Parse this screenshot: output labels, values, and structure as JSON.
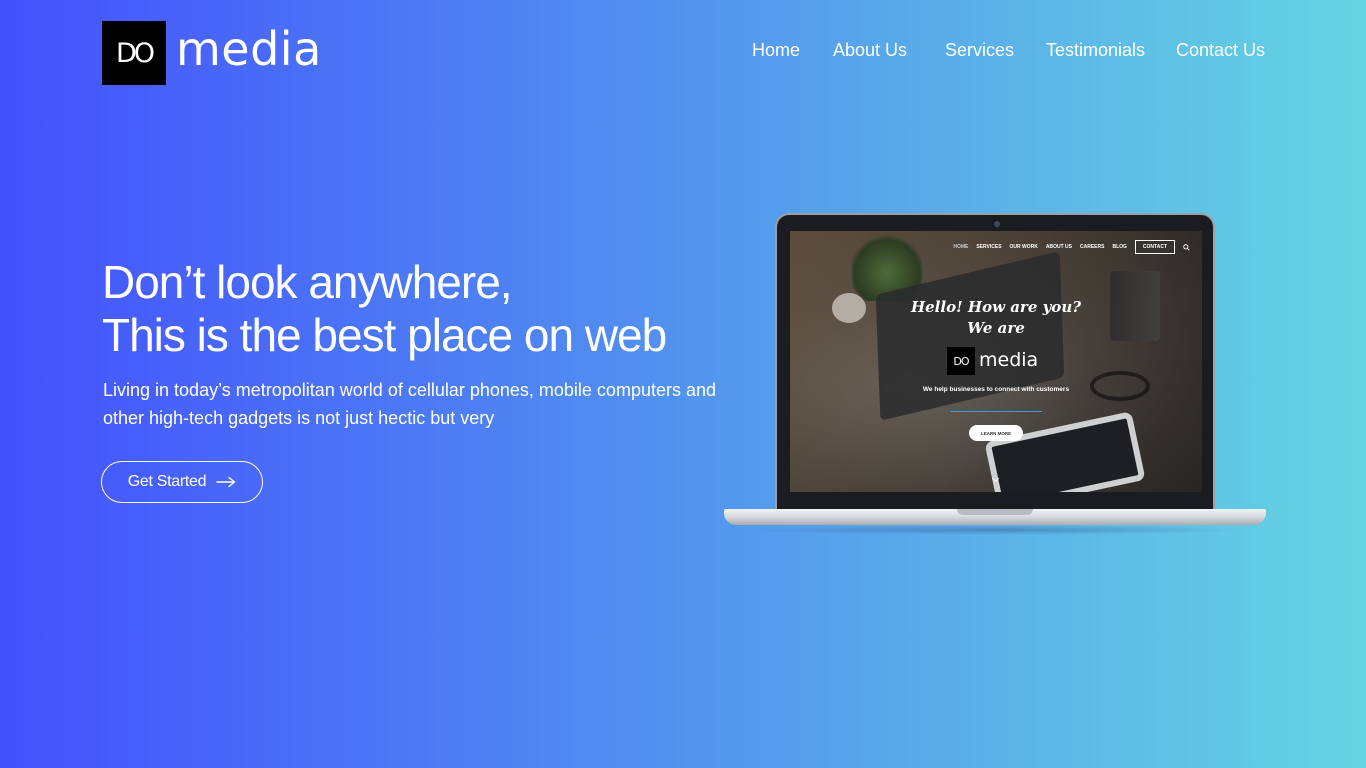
{
  "brand": {
    "logo_mark": "DO",
    "logo_word": "media"
  },
  "nav": {
    "items": [
      {
        "label": "Home"
      },
      {
        "label": "About Us"
      },
      {
        "label": "Services"
      },
      {
        "label": "Testimonials"
      },
      {
        "label": "Contact Us"
      }
    ]
  },
  "hero": {
    "title_line1": "Don’t look anywhere,",
    "title_line2": "This is the best place on web",
    "text": "Living in today’s metropolitan world of cellular phones, mobile computers and other high-tech gadgets is not just hectic but very",
    "cta_label": "Get Started",
    "cta_icon": "arrow-right-icon"
  },
  "screen_preview": {
    "nav": [
      "HOME",
      "SERVICES",
      "OUR WORK",
      "ABOUT US",
      "CAREERS",
      "BLOG"
    ],
    "contact_label": "CONTACT",
    "search_icon": "search-icon",
    "hello_line1": "Hello! How are you?",
    "hello_line2": "We are",
    "logo_mark": "DO",
    "logo_word": "media",
    "tagline": "We help businesses to connect with customers",
    "button": "LEARN MORE"
  },
  "colors": {
    "gradient_start": "#4451fd",
    "gradient_end": "#64d4e2",
    "text": "#ffffff",
    "logo_box": "#000000"
  }
}
